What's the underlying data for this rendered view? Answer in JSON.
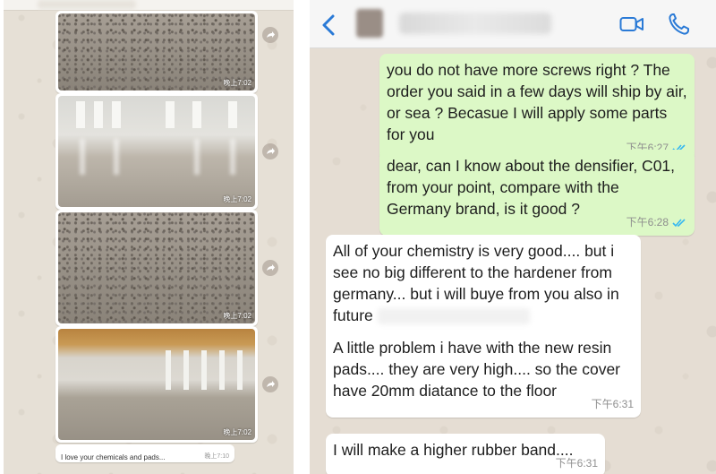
{
  "left_chat": {
    "photos": [
      {
        "time": "晚上7:02"
      },
      {
        "time": "晚上7:02"
      },
      {
        "time": "晚上7:02"
      },
      {
        "time": "晚上7:02"
      }
    ],
    "caption": {
      "text": "I love your chemicals and pads...",
      "time": "晚上7:10"
    }
  },
  "right_chat": {
    "messages": [
      {
        "direction": "out",
        "text": "you do not have more screws right ? The order you said in a few days will ship by air, or sea ? Becasue I will apply some parts for you",
        "time": "下午6:27",
        "status": "read"
      },
      {
        "direction": "out",
        "text": "dear, can I know about the densifier, C01, from your point, compare with the Germany brand, is it good ?",
        "time": "下午6:28",
        "status": "read"
      },
      {
        "direction": "in",
        "text_part1": "All of your chemistry is very good.... but i see no big different to the hardener from germany... but i will buye from you also in future",
        "text_part2": "A little problem i have with the new resin pads.... they are very high.... so the cover have 20mm diatance to the floor",
        "time": "下午6:31"
      },
      {
        "direction": "in",
        "text": "I will make a higher rubber band....",
        "time": "下午6:31"
      }
    ]
  },
  "colors": {
    "outgoing_bubble": "#dcf8c6",
    "incoming_bubble": "#ffffff",
    "ios_blue": "#2a7ad6",
    "read_ticks": "#34b7f1"
  },
  "icons": [
    "chevron-left-icon",
    "video-icon",
    "phone-icon",
    "share-icon",
    "double-check-icon"
  ]
}
